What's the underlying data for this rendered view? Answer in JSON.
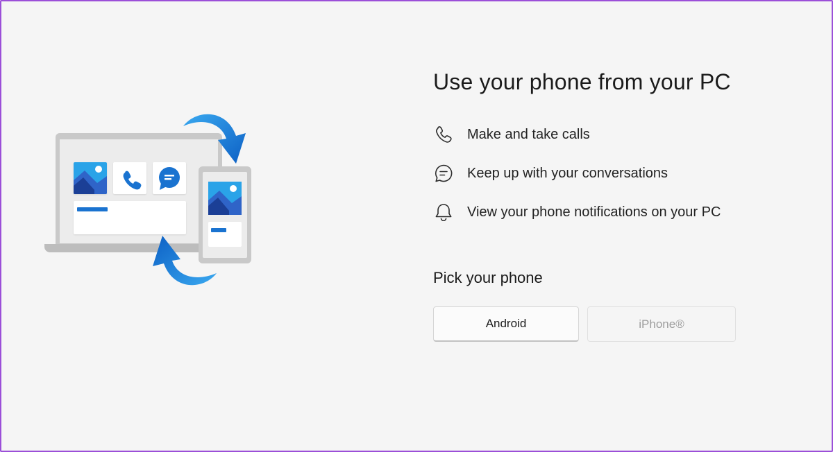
{
  "main": {
    "title": "Use your phone from your PC",
    "features": [
      {
        "icon": "phone-call-icon",
        "label": "Make and take calls"
      },
      {
        "icon": "chat-bubble-icon",
        "label": "Keep up with your conversations"
      },
      {
        "icon": "bell-icon",
        "label": "View your phone notifications on your PC"
      }
    ],
    "pick_title": "Pick your phone",
    "buttons": {
      "android_label": "Android",
      "iphone_label": "iPhone®"
    }
  },
  "colors": {
    "background": "#f5f5f5",
    "accent_blue": "#1a73d0",
    "window_border": "#9b4fd8",
    "disabled_text": "#9d9d9d"
  }
}
